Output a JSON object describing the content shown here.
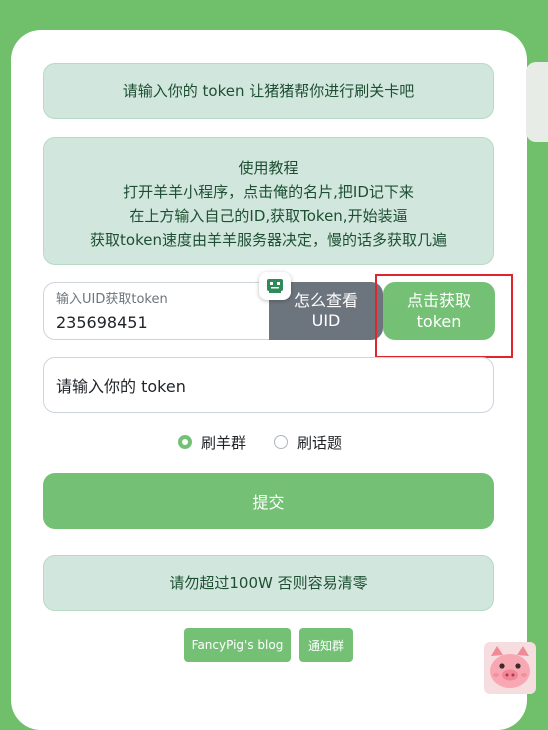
{
  "notices": {
    "top": "请输入你的 token 让猪猪帮你进行刷关卡吧",
    "tutorial": [
      "使用教程",
      "打开羊羊小程序，点击俺的名片,把ID记下来",
      "在上方输入自己的ID,获取Token,开始装逼",
      "获取token速度由羊羊服务器决定，慢的话多获取几遍"
    ],
    "bottom": "请勿超过100W 否则容易清零"
  },
  "uid": {
    "label": "输入UID获取token",
    "value": "235698451",
    "howto_line1": "怎么查看",
    "howto_line2": "UID"
  },
  "get_token": {
    "line1": "点击获取",
    "line2": "token"
  },
  "token_input": {
    "placeholder": "请输入你的 token"
  },
  "modes": {
    "option1": "刷羊群",
    "option2": "刷话题",
    "selected": "刷羊群"
  },
  "submit_label": "提交",
  "links": {
    "blog": "FancyPig's blog",
    "group": "通知群"
  },
  "colors": {
    "primary": "#74c176",
    "alert_bg": "#d1e7dd",
    "secondary": "#6c757d",
    "highlight": "#e0262c"
  },
  "icons": {
    "robot": "robot-icon",
    "mascot": "pig-mascot-icon"
  }
}
